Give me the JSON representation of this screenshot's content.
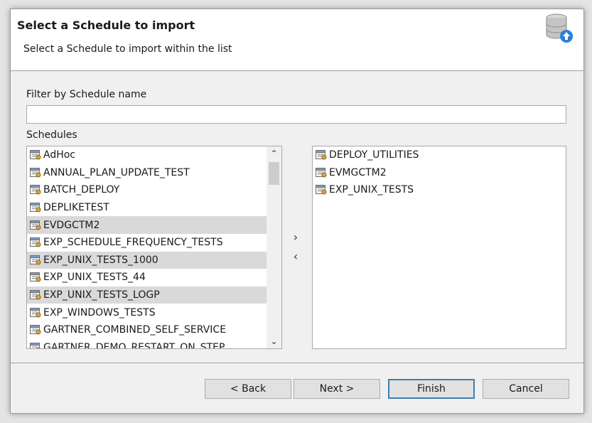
{
  "header": {
    "title": "Select a Schedule to import",
    "subtitle": "Select a Schedule to import within the list",
    "icon": "database-import-icon"
  },
  "filter": {
    "label": "Filter by Schedule name",
    "value": "",
    "placeholder": ""
  },
  "schedules_label": "Schedules",
  "available": {
    "items": [
      {
        "label": "AdHoc",
        "selected": false
      },
      {
        "label": "ANNUAL_PLAN_UPDATE_TEST",
        "selected": false
      },
      {
        "label": "BATCH_DEPLOY",
        "selected": false
      },
      {
        "label": "DEPLIKETEST",
        "selected": false
      },
      {
        "label": "EVDGCTM2",
        "selected": true
      },
      {
        "label": "EXP_SCHEDULE_FREQUENCY_TESTS",
        "selected": false
      },
      {
        "label": "EXP_UNIX_TESTS_1000",
        "selected": true
      },
      {
        "label": "EXP_UNIX_TESTS_44",
        "selected": false
      },
      {
        "label": "EXP_UNIX_TESTS_LOGP",
        "selected": true
      },
      {
        "label": "EXP_WINDOWS_TESTS",
        "selected": false
      },
      {
        "label": "GARTNER_COMBINED_SELF_SERVICE",
        "selected": false
      },
      {
        "label": "GARTNER_DEMO_RESTART_ON_STEP",
        "selected": false
      }
    ]
  },
  "selected_list": {
    "items": [
      {
        "label": "DEPLOY_UTILITIES"
      },
      {
        "label": "EVMGCTM2"
      },
      {
        "label": "EXP_UNIX_TESTS"
      }
    ]
  },
  "arrows": {
    "move_right": "›",
    "move_left": "‹",
    "scroll_up": "⌃",
    "scroll_down": "⌄"
  },
  "buttons": {
    "back": "< Back",
    "next": "Next >",
    "finish": "Finish",
    "cancel": "Cancel"
  }
}
